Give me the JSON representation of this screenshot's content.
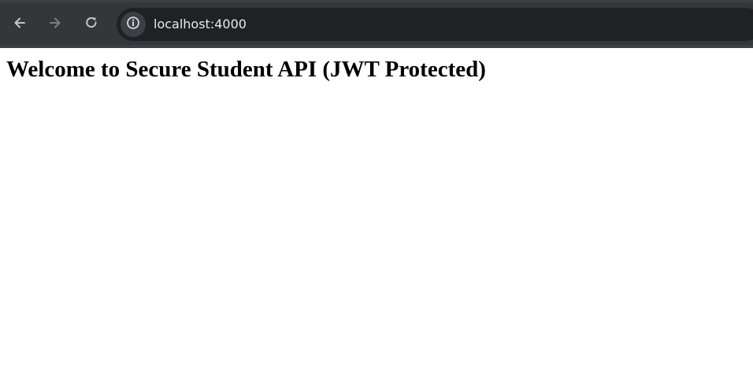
{
  "browser": {
    "url": "localhost:4000",
    "icons": {
      "back": "back-arrow-icon",
      "forward": "forward-arrow-icon",
      "reload": "reload-icon",
      "site_info": "info-icon"
    },
    "colors": {
      "toolbar": "#35363a",
      "omnibox": "#202124",
      "url_text": "#e8eaed"
    }
  },
  "page": {
    "heading": "Welcome to Secure Student API (JWT Protected)"
  }
}
